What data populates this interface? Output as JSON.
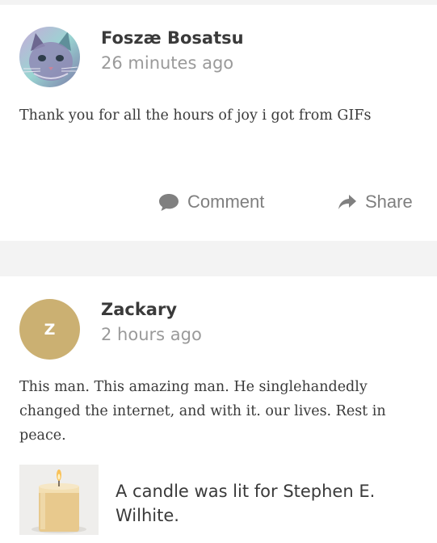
{
  "posts": [
    {
      "author": "Foszæ Bosatsu",
      "time": "26 minutes ago",
      "avatar_icon": "cat-avatar-icon",
      "text": "Thank you for all the hours of joy i got from GIFs",
      "actions": {
        "comment_label": "Comment",
        "share_label": "Share"
      }
    },
    {
      "author": "Zackary",
      "time": "2 hours ago",
      "avatar_letter": "Z",
      "avatar_color": "#cbb072",
      "text": "This man. This amazing man. He singlehandedly changed the internet, and with it. our lives. Rest in peace.",
      "candle": {
        "icon": "candle-icon",
        "text": "A candle was lit for Stephen E. Wilhite."
      }
    }
  ],
  "colors": {
    "page_background": "#f3f3f3",
    "card_background": "#ffffff",
    "author_text": "#3a3a3a",
    "muted_text": "#9a9a9a",
    "action_text": "#7f7f7f"
  }
}
